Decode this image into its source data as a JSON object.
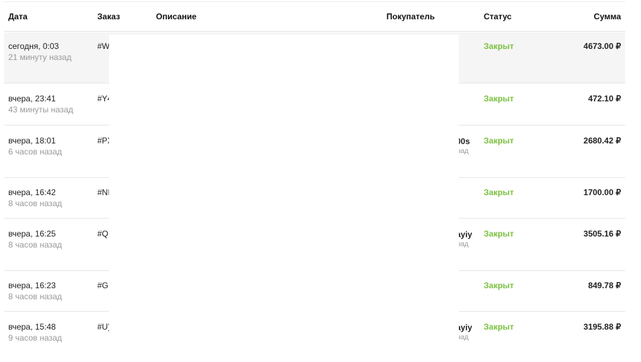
{
  "headers": {
    "date": "Дата",
    "order": "Заказ",
    "description": "Описание",
    "buyer": "Покупатель",
    "status": "Статус",
    "amount": "Сумма"
  },
  "status_color": "#7cc142",
  "rows": [
    {
      "date": "сегодня, 0:03",
      "ago": "21 минуту назад",
      "order": "#W",
      "buyer": "",
      "buyer_sub": "",
      "status": "Закрыт",
      "amount": "4673.00 ₽"
    },
    {
      "date": "вчера, 23:41",
      "ago": "43 минуты назад",
      "order": "#Y4",
      "buyer": "",
      "buyer_sub": "",
      "status": "Закрыт",
      "amount": "472.10 ₽"
    },
    {
      "date": "вчера, 18:01",
      "ago": "6 часов назад",
      "order": "#PX",
      "buyer": "00s",
      "buyer_sub": "зад",
      "status": "Закрыт",
      "amount": "2680.42 ₽"
    },
    {
      "date": "вчера, 16:42",
      "ago": "8 часов назад",
      "order": "#NI",
      "buyer": "",
      "buyer_sub": "",
      "status": "Закрыт",
      "amount": "1700.00 ₽"
    },
    {
      "date": "вчера, 16:25",
      "ago": "8 часов назад",
      "order": "#QI",
      "buyer": "ayiy",
      "buyer_sub": "зад",
      "status": "Закрыт",
      "amount": "3505.16 ₽"
    },
    {
      "date": "вчера, 16:23",
      "ago": "8 часов назад",
      "order": "#G",
      "buyer": "",
      "buyer_sub": "",
      "status": "Закрыт",
      "amount": "849.78 ₽"
    },
    {
      "date": "вчера, 15:48",
      "ago": "9 часов назад",
      "order": "#U)",
      "buyer": "ayiy",
      "buyer_sub": "зад",
      "status": "Закрыт",
      "amount": "3195.88 ₽"
    }
  ]
}
